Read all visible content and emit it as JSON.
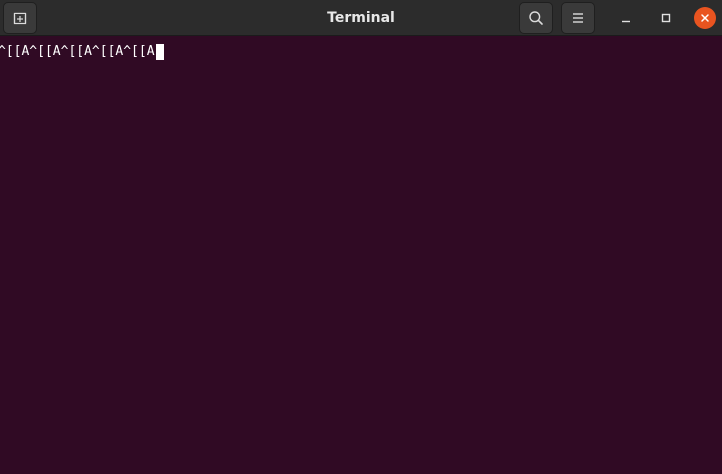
{
  "window": {
    "title": "Terminal"
  },
  "titlebar": {
    "new_tab_icon": "new-tab-icon",
    "search_icon": "search-icon",
    "menu_icon": "hamburger-menu-icon",
    "minimize_icon": "minimize-icon",
    "maximize_icon": "maximize-icon",
    "close_icon": "close-icon"
  },
  "terminal": {
    "line": "^[[A^[[A^[[A^[[A^[[A"
  },
  "colors": {
    "terminal_background": "#300a24",
    "titlebar_background": "#2c2c2c",
    "close_button": "#e95420",
    "text": "#ffffff"
  }
}
